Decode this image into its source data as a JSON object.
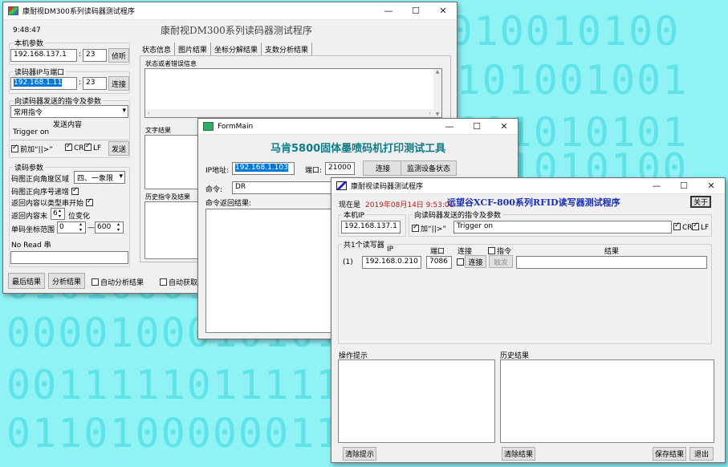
{
  "background": {
    "rows": [
      "0101010010100",
      "0100101001001",
      "0101001010101",
      "0010101010100",
      "0101000110101",
      "0000100010101",
      "0011111011111",
      "0110100000011"
    ]
  },
  "win1": {
    "title": "康耐视DM300系列读码器测试程序",
    "time": "9:48:47",
    "heading": "康耐视DM300系列读码器测试程序",
    "local_group": "本机参数",
    "local_ip": "192.168.137.1",
    "local_port": "23",
    "listen_btn": "侦听",
    "reader_group": "读码器IP与端口",
    "reader_ip": "192.168.1.11",
    "reader_port": "23",
    "connect_btn": "连接",
    "cmd_group": "向读码器发送的指令及参数",
    "cmd_select": "常用指令",
    "send_content_label": "发送内容",
    "send_content": "Trigger on",
    "prefix_label": "前加“||>”",
    "cr_label": "CR",
    "lf_label": "LF",
    "send_btn": "发送",
    "read_group": "读码参数",
    "angle_label": "码图正向角度区域",
    "angle_select": "四、一象限",
    "ascend_label": "码图正向序号递增",
    "type_start_label": "返回内容以类型串开始",
    "tail_label": "返回内容末",
    "tail_value": "6",
    "tail_suffix": "位变化",
    "range_label": "单码坐标范围",
    "range_min": "0",
    "range_dash": "—",
    "range_max": "600",
    "noread_label": "No Read 串",
    "noread_value": "",
    "tabs": [
      "状态信息",
      "图片结果",
      "坐标分解结果",
      "支数分析结果"
    ],
    "status_box_label": "状态或者错误信息",
    "text_result_label": "文字结果",
    "history_label": "历史指令及结果",
    "last_result_btn": "最后结果",
    "analyze_btn": "分析结果",
    "auto_analyze_label": "自动分析结果",
    "auto_get_label": "自动获取"
  },
  "win2": {
    "title": "FormMain",
    "heading": "马肯5800固体墨喷码机打印测试工具",
    "ip_label": "IP地址:",
    "ip_value": "192.168.1.103",
    "port_label": "端口:",
    "port_value": "21000",
    "connect_btn": "连接",
    "monitor_btn": "监测设备状态",
    "cmd_label": "命令:",
    "cmd_value": "DR",
    "return_label": "命令返回结果:"
  },
  "win3": {
    "title": "康耐视读码器测试程序",
    "now_label": "现在是",
    "datetime": "2019年08月14日  9:53:01",
    "heading": "远望谷XCF-800系列RFID读写器测试程序",
    "about_btn": "关于",
    "local_group": "本机IP",
    "local_ip": "192.168.137.1",
    "cmd_group": "向读码器发送的指令及参数",
    "prefix_label": "加“||>”",
    "cmd_value": "Trigger on",
    "cr_label": "CR",
    "lf_label": "LF",
    "reader_group": "共1个读写器",
    "col_ip": "IP",
    "col_port": "端口",
    "col_connect": "连接",
    "col_cmd": "指令",
    "col_result": "结果",
    "row_index": "(1)",
    "row_ip": "192.168.0.210",
    "row_port": "7086",
    "row_connect_btn": "连接",
    "row_send_btn": "触发",
    "op_hint_label": "操作提示",
    "history_label": "历史结果",
    "clear_hint_btn": "清除提示",
    "clear_result_btn": "清除结果",
    "save_result_btn": "保存结果",
    "exit_btn": "退出"
  }
}
